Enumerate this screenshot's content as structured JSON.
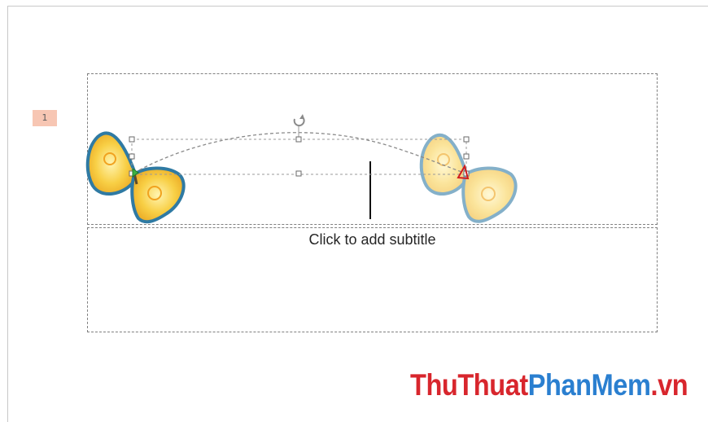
{
  "slide": {
    "animation_tag": "1",
    "subtitle_placeholder": "Click to add subtitle"
  },
  "watermark": {
    "part1": "ThuThuat",
    "part2": "PhanMem",
    "part3": ".vn"
  },
  "colors": {
    "anim_tag_bg": "#f7c6b3",
    "watermark_red": "#d8262d",
    "watermark_blue": "#2a7fd0",
    "butterfly_wing": "#f6c23a",
    "butterfly_outline": "#3c7fa6",
    "motion_path": "#8a8a8a"
  },
  "icons": [
    "butterfly-icon",
    "rotate-handle-icon",
    "end-arrow-icon"
  ]
}
